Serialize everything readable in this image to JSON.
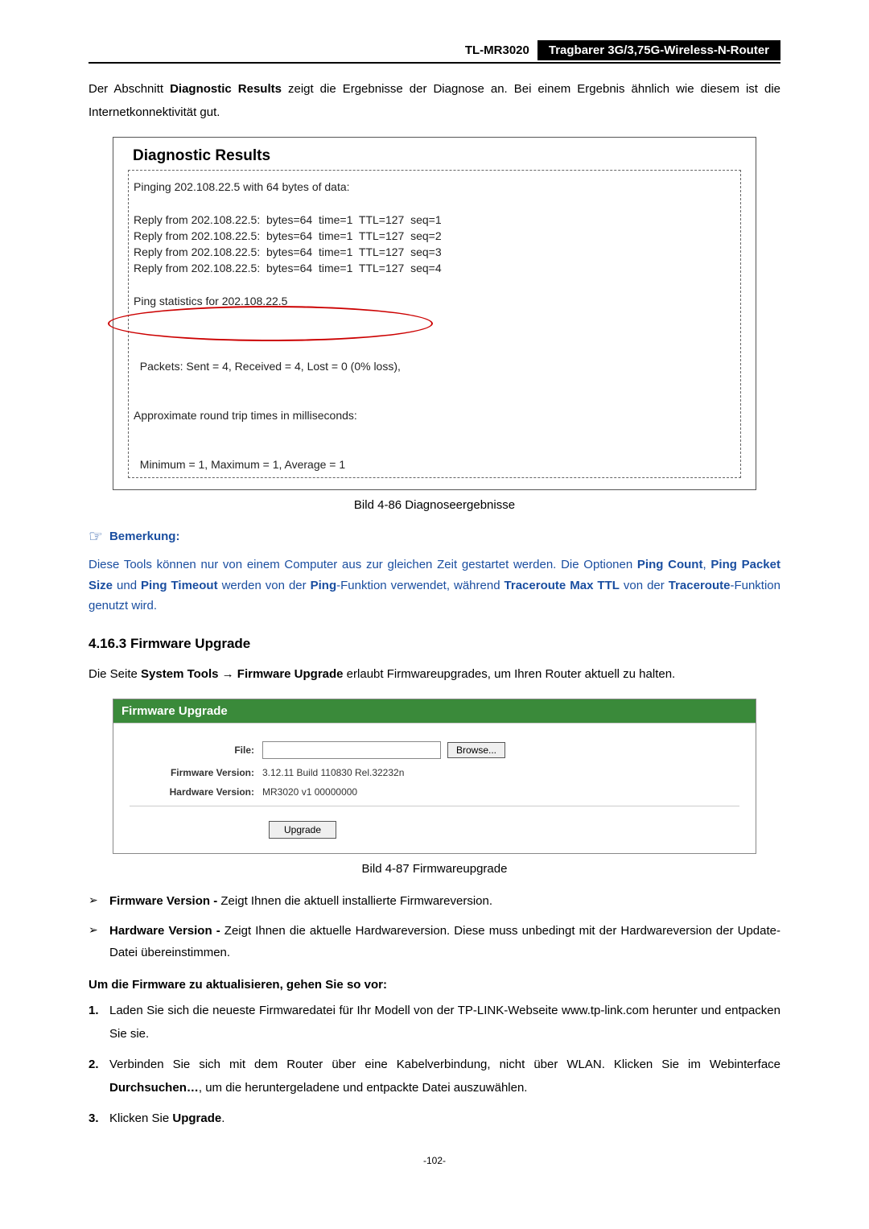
{
  "header": {
    "model": "TL-MR3020",
    "description": "Tragbarer 3G/3,75G-Wireless-N-Router"
  },
  "intro": {
    "prefix": "Der Abschnitt ",
    "bold1": "Diagnostic Results",
    "rest": " zeigt die Ergebnisse der Diagnose an. Bei einem Ergebnis ähnlich wie diesem ist die Internetkonnektivität gut."
  },
  "diag": {
    "title": "Diagnostic Results",
    "ping_header": "Pinging 202.108.22.5 with 64 bytes of data:",
    "replies": [
      "Reply from 202.108.22.5:  bytes=64  time=1  TTL=127  seq=1",
      "Reply from 202.108.22.5:  bytes=64  time=1  TTL=127  seq=2",
      "Reply from 202.108.22.5:  bytes=64  time=1  TTL=127  seq=3",
      "Reply from 202.108.22.5:  bytes=64  time=1  TTL=127  seq=4"
    ],
    "stats_header": "Ping statistics for 202.108.22.5",
    "packets": "  Packets: Sent = 4, Received = 4, Lost = 0 (0% loss),",
    "approx": "Approximate round trip times in milliseconds:",
    "minmax": "  Minimum = 1, Maximum = 1, Average = 1"
  },
  "caption1": "Bild 4-86 Diagnoseergebnisse",
  "bemerkung": {
    "label": "Bemerkung:",
    "text_parts": {
      "p1": "Diese Tools können nur von einem Computer aus zur gleichen Zeit gestartet werden. Die Optionen ",
      "b1": "Ping Count",
      "s1": ", ",
      "b2": "Ping Packet Size",
      "s2": " und ",
      "b3": "Ping Timeout",
      "s3": " werden von der ",
      "b4": "Ping",
      "s4": "-Funktion verwendet, während ",
      "b5": "Traceroute Max TTL",
      "s5": " von der ",
      "b6": "Traceroute",
      "s6": "-Funktion genutzt wird."
    }
  },
  "section": {
    "heading": "4.16.3  Firmware Upgrade",
    "para_prefix": "Die Seite ",
    "para_bold": "System Tools → Firmware Upgrade",
    "para_rest": " erlaubt Firmwareupgrades, um Ihren Router aktuell zu halten."
  },
  "fw": {
    "header": "Firmware Upgrade",
    "file_label": "File:",
    "browse": "Browse...",
    "fw_ver_label": "Firmware Version:",
    "fw_ver_value": "3.12.11 Build 110830 Rel.32232n",
    "hw_ver_label": "Hardware Version:",
    "hw_ver_value": "MR3020 v1 00000000",
    "upgrade": "Upgrade"
  },
  "caption2": "Bild 4-87 Firmwareupgrade",
  "bullets": [
    {
      "bold": "Firmware Version - ",
      "text": "Zeigt Ihnen die aktuell installierte Firmwareversion."
    },
    {
      "bold": "Hardware Version - ",
      "text": "Zeigt Ihnen die aktuelle Hardwareversion. Diese muss unbedingt mit der Hardwareversion der Update-Datei übereinstimmen."
    }
  ],
  "instr_heading": "Um die Firmware zu aktualisieren, gehen Sie so vor:",
  "steps": [
    {
      "num": "1.",
      "text": "Laden Sie sich die neueste Firmwaredatei für Ihr Modell von der TP-LINK-Webseite www.tp-link.com herunter und entpacken Sie sie."
    },
    {
      "num": "2.",
      "pre": "Verbinden Sie sich mit dem Router über eine Kabelverbindung, nicht über WLAN. Klicken Sie im Webinterface ",
      "bold": "Durchsuchen…",
      "post": ", um die heruntergeladene und entpackte Datei auszuwählen."
    },
    {
      "num": "3.",
      "pre": "Klicken Sie ",
      "bold": "Upgrade",
      "post": "."
    }
  ],
  "page_number": "-102-"
}
